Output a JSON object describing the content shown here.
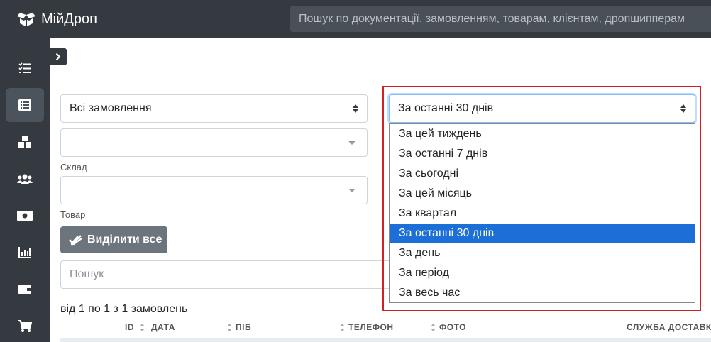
{
  "app": {
    "title": "МійДроп"
  },
  "topbar": {
    "search_placeholder": "Пошук по документації, замовленням, товарам, клієнтам, дропшипперам"
  },
  "sidebar": {
    "items": [
      {
        "icon": "tasks-icon"
      },
      {
        "icon": "list-icon",
        "active": true
      },
      {
        "icon": "boxes-icon"
      },
      {
        "icon": "users-icon"
      },
      {
        "icon": "money-icon"
      },
      {
        "icon": "chart-icon"
      },
      {
        "icon": "wallet-icon"
      },
      {
        "icon": "cart-icon"
      }
    ]
  },
  "filters": {
    "order_status": {
      "selected": "Всі замовлення"
    },
    "warehouse": {
      "value": "",
      "label": "Склад"
    },
    "product": {
      "value": "",
      "label": "Товар"
    },
    "period": {
      "selected": "За останні 30 днів",
      "options": [
        "За цей тиждень",
        "За останні 7 днів",
        "За сьогодні",
        "За цей місяць",
        "За квартал",
        "За останні 30 днів",
        "За день",
        "За період",
        "За весь час"
      ],
      "selected_index": 5
    }
  },
  "actions": {
    "select_all_label": "Виділити все"
  },
  "search": {
    "placeholder": "Пошук"
  },
  "summary": {
    "count_text": "від 1 по 1 з 1 замовлень"
  },
  "table": {
    "columns": [
      "ID",
      "ДАТА",
      "ПІБ",
      "ТЕЛЕФОН",
      "ФОТО",
      "СЛУЖБА ДОСТАВКИ"
    ]
  },
  "colors": {
    "topbar": "#343a40",
    "selected_option": "#1d6fd8",
    "highlight": "#d42020",
    "button": "#6c757d"
  }
}
